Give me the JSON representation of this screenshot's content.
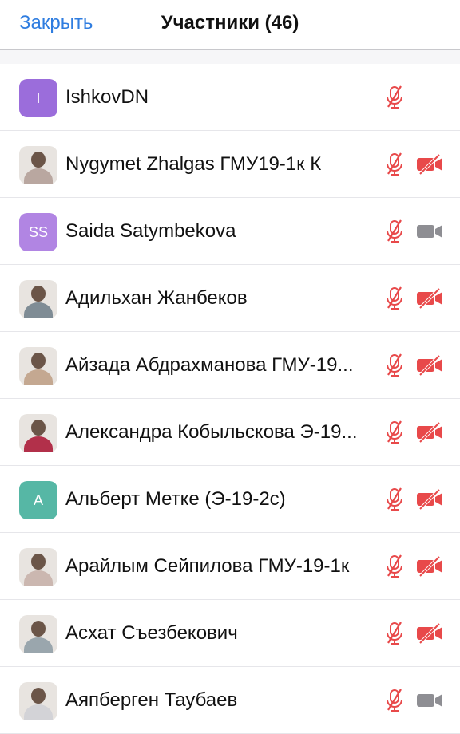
{
  "header": {
    "close_label": "Закрыть",
    "title": "Участники (46)"
  },
  "colors": {
    "accent": "#2f7de0",
    "muted_red": "#e8494a",
    "camera_gray": "#8e8e93"
  },
  "participants": [
    {
      "name": "IshkovDN",
      "avatar_text": "I",
      "avatar_color": "#9b6ddb",
      "avatar_type": "initial",
      "mic": "muted",
      "video": "none"
    },
    {
      "name": "Nygymet Zhalgas ГМУ19-1к К",
      "avatar_text": "",
      "avatar_color": "#b9a7a0",
      "avatar_type": "photo",
      "mic": "muted",
      "video": "off"
    },
    {
      "name": "Saida Satymbekova",
      "avatar_text": "SS",
      "avatar_color": "#b185e3",
      "avatar_type": "initial",
      "mic": "muted",
      "video": "on"
    },
    {
      "name": "Адильхан Жанбеков",
      "avatar_text": "",
      "avatar_color": "#7f8c95",
      "avatar_type": "photo",
      "mic": "muted",
      "video": "off"
    },
    {
      "name": "Айзада Абдрахманова ГМУ-19...",
      "avatar_text": "",
      "avatar_color": "#c4a891",
      "avatar_type": "photo",
      "mic": "muted",
      "video": "off"
    },
    {
      "name": "Александра Кобыльскова Э-19...",
      "avatar_text": "",
      "avatar_color": "#b2304a",
      "avatar_type": "photo",
      "mic": "muted",
      "video": "off"
    },
    {
      "name": "Альберт Метке (Э-19-2с)",
      "avatar_text": "A",
      "avatar_color": "#56b7a5",
      "avatar_type": "initial",
      "mic": "muted",
      "video": "off"
    },
    {
      "name": "Арайлым Сейпилова ГМУ-19-1к",
      "avatar_text": "",
      "avatar_color": "#cbb7b0",
      "avatar_type": "photo",
      "mic": "muted",
      "video": "off"
    },
    {
      "name": "Асхат Съезбекович",
      "avatar_text": "",
      "avatar_color": "#9aa6ad",
      "avatar_type": "photo",
      "mic": "muted",
      "video": "off"
    },
    {
      "name": "Аяпберген Таубаев",
      "avatar_text": "",
      "avatar_color": "#d3d3d7",
      "avatar_type": "photo",
      "mic": "muted",
      "video": "on"
    }
  ]
}
